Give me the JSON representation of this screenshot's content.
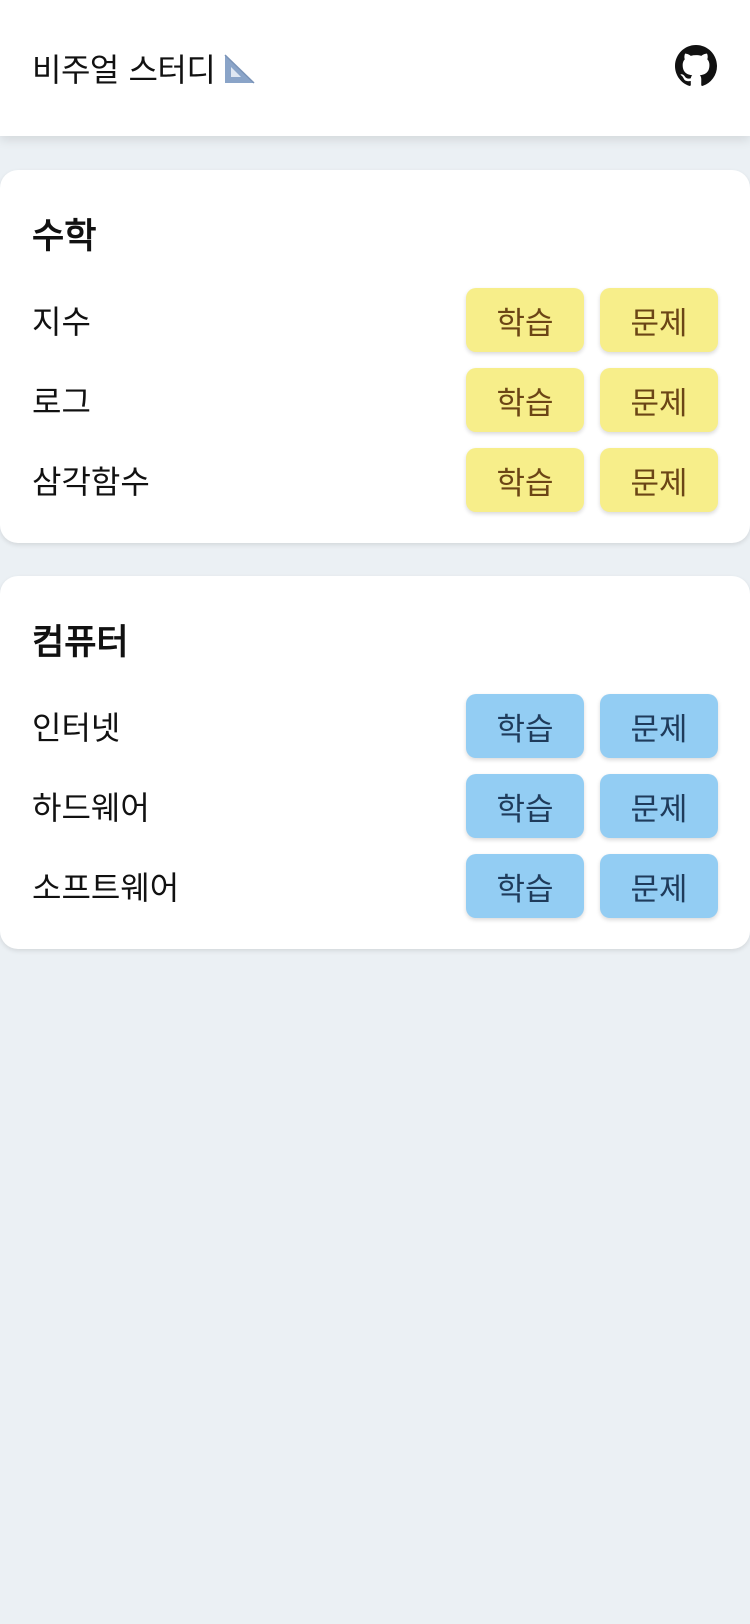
{
  "header": {
    "title": "비주얼 스터디",
    "title_icon": "triangle-ruler-icon",
    "github_icon": "github-icon"
  },
  "colors": {
    "math_button_bg": "#f7ee8a",
    "math_button_text": "#6b4516",
    "computer_button_bg": "#93cdf3",
    "computer_button_text": "#1f3b5b",
    "page_bg": "#ebf0f4"
  },
  "sections": [
    {
      "title": "수학",
      "items": [
        {
          "label": "지수",
          "learn": "학습",
          "quiz": "문제"
        },
        {
          "label": "로그",
          "learn": "학습",
          "quiz": "문제"
        },
        {
          "label": "삼각함수",
          "learn": "학습",
          "quiz": "문제"
        }
      ]
    },
    {
      "title": "컴퓨터",
      "items": [
        {
          "label": "인터넷",
          "learn": "학습",
          "quiz": "문제"
        },
        {
          "label": "하드웨어",
          "learn": "학습",
          "quiz": "문제"
        },
        {
          "label": "소프트웨어",
          "learn": "학습",
          "quiz": "문제"
        }
      ]
    }
  ]
}
